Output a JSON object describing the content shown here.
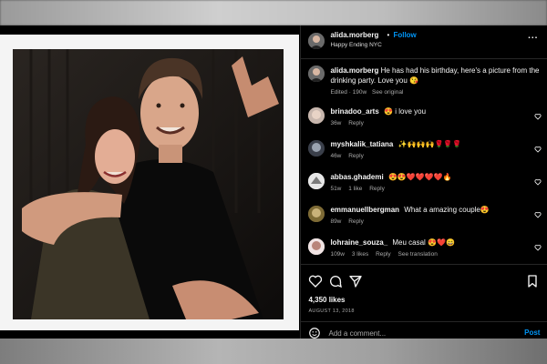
{
  "post": {
    "username": "alida.morberg",
    "follow_label": "Follow",
    "dot": "•",
    "location": "Happy Ending NYC",
    "more_label": "...",
    "caption": {
      "username": "alida.morberg",
      "text": "He has had his birthday, here's a picture from the drinking party. Love you 😘",
      "edited": "Edited",
      "sep": "·",
      "age": "190w",
      "see_original": "See original"
    }
  },
  "comments": [
    {
      "user": "brinadoo_arts",
      "text": "😍 i love you",
      "age": "36w",
      "likes": "",
      "reply": "Reply",
      "translation": ""
    },
    {
      "user": "myshkalik_tatiana",
      "text": "✨🙌🙌🙌🌹🌹🌹",
      "age": "46w",
      "likes": "",
      "reply": "Reply",
      "translation": ""
    },
    {
      "user": "abbas.ghademi",
      "text": "😍😍❤️❤️❤️❤️🔥",
      "age": "51w",
      "likes": "1 like",
      "reply": "Reply",
      "translation": ""
    },
    {
      "user": "emmanuellbergman",
      "text": "What a amazing couple😍",
      "age": "89w",
      "likes": "",
      "reply": "Reply",
      "translation": ""
    },
    {
      "user": "lohraine_souza_",
      "text": "Meu casal 😍❤️😄",
      "age": "109w",
      "likes": "3 likes",
      "reply": "Reply",
      "translation": "See translation"
    }
  ],
  "footer": {
    "likes": "4,350 likes",
    "date": "AUGUST 13, 2018",
    "comment_placeholder": "Add a comment...",
    "post_label": "Post"
  },
  "icons": {
    "like": "heart-outline-icon",
    "comment": "speech-bubble-icon",
    "share": "paper-plane-icon",
    "save": "bookmark-icon",
    "emoji": "smiley-icon",
    "more": "more-options-icon"
  },
  "colors": {
    "accent_blue": "#0095f6",
    "panel_bg": "#000000",
    "muted_text": "#a8a8a8",
    "divider": "#262626"
  }
}
